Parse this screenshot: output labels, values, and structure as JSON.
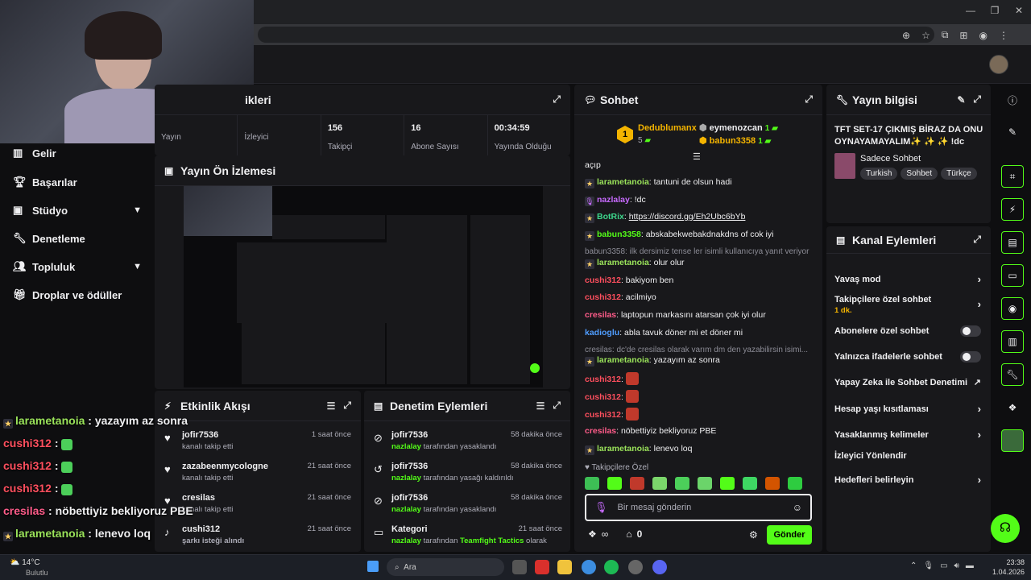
{
  "browser": {
    "min": "—",
    "max": "❐",
    "close": "✕"
  },
  "sidebar": {
    "items": [
      {
        "label": "Gelir",
        "icon": "bar-chart-icon"
      },
      {
        "label": "Başarılar",
        "icon": "trophy-icon"
      },
      {
        "label": "Stüdyo",
        "icon": "video-icon",
        "chevron": true
      },
      {
        "label": "Denetleme",
        "icon": "wrench-icon"
      },
      {
        "label": "Topluluk",
        "icon": "people-icon",
        "chevron": true
      },
      {
        "label": "Droplar ve ödüller",
        "icon": "gift-icon"
      }
    ]
  },
  "stats": {
    "title_fragment": "ikleri",
    "cells": [
      {
        "value": "",
        "label": "Yayın"
      },
      {
        "value": "",
        "label": "İzleyici"
      },
      {
        "value": "156",
        "label": "Takipçi"
      },
      {
        "value": "16",
        "label": "Abone Sayısı"
      },
      {
        "value": "00:34:59",
        "label": "Yayında Olduğu"
      }
    ]
  },
  "preview": {
    "title": "Yayın Ön İzlemesi"
  },
  "activity": {
    "title": "Etkinlik Akışı",
    "items": [
      {
        "user": "jofir7536",
        "desc": "kanalı takip etti",
        "time": "1 saat önce"
      },
      {
        "user": "zazabeenmycologne",
        "desc": "kanalı takip etti",
        "time": "21 saat önce"
      },
      {
        "user": "cresilas",
        "desc": "kanalı takip etti",
        "time": "21 saat önce"
      },
      {
        "user": "cushi312",
        "desc": "şarkı isteği alındı",
        "time": "21 saat önce"
      }
    ]
  },
  "moderation": {
    "title": "Denetim Eylemleri",
    "items": [
      {
        "user": "jofir7536",
        "by": "nazlalay",
        "desc": "tarafından yasaklandı",
        "time": "58 dakika önce"
      },
      {
        "user": "jofir7536",
        "by": "nazlalay",
        "desc": "tarafından yasağı kaldırıldı",
        "time": "58 dakika önce"
      },
      {
        "user": "jofir7536",
        "by": "nazlalay",
        "desc": "tarafından yasaklandı",
        "time": "58 dakika önce"
      },
      {
        "user": "Kategori",
        "by": "nazlalay",
        "desc": "tarafından",
        "extra": "Teamfight Tactics",
        "tail": "olarak",
        "time": "21 saat önce"
      }
    ]
  },
  "chat": {
    "title": "Sohbet",
    "leader": {
      "rank": "1",
      "name": "Dedublumanx",
      "count": "5"
    },
    "leaders2": [
      {
        "name": "eymenozcan",
        "count": "1"
      },
      {
        "name": "babun3358",
        "count": "1"
      }
    ],
    "lines": [
      {
        "user": "",
        "msg": "açıp",
        "cls": ""
      },
      {
        "user": "larametanoia",
        "msg": ": tantuni de olsun hadi",
        "cls": "u-lara",
        "badge": true
      },
      {
        "user": "nazlalay",
        "msg": ": !dc",
        "cls": "u-naz",
        "mic": true
      },
      {
        "user": "BotRix",
        "msg": ": ",
        "link": "https://discord.gg/Eh2Ubc6bYb",
        "cls": "u-bot",
        "badge": true
      },
      {
        "user": "babun3358",
        "msg": ": abskabekwebakdnakdns of cok iyi",
        "cls": "u-bab",
        "badge": true
      },
      {
        "reply": "babun3358: ilk dersimiz tense ler isimli kullanıcıya yanıt veriyor"
      },
      {
        "user": "larametanoia",
        "msg": ": olur olur",
        "cls": "u-lara",
        "badge": true
      },
      {
        "user": "cushi312",
        "msg": ": bakiyom ben",
        "cls": "u-cushi"
      },
      {
        "user": "cushi312",
        "msg": ": acilmiyo",
        "cls": "u-cushi"
      },
      {
        "user": "cresilas",
        "msg": ": laptopun markasını atarsan çok iyi olur",
        "cls": "u-cres"
      },
      {
        "user": "kadioglu",
        "msg": ": abla tavuk döner mi et döner mi",
        "cls": "u-kad"
      },
      {
        "reply": "cresilas: dc'de cresilas olarak varım dm den yazabilirsin isimi..."
      },
      {
        "user": "larametanoia",
        "msg": ": yazayım az sonra",
        "cls": "u-lara",
        "badge": true
      },
      {
        "user": "cushi312",
        "msg": ": ",
        "cls": "u-cushi",
        "emote": true
      },
      {
        "user": "cushi312",
        "msg": ": ",
        "cls": "u-cushi",
        "emote": true
      },
      {
        "user": "cushi312",
        "msg": ": ",
        "cls": "u-cushi",
        "emote": true
      },
      {
        "user": "cresilas",
        "msg": ": nöbettiyiz bekliyoruz PBE",
        "cls": "u-cres"
      },
      {
        "user": "larametanoia",
        "msg": ": lenevo loq",
        "cls": "u-lara",
        "badge": true
      }
    ],
    "followers_only": "Takipçilere Özel",
    "input_placeholder": "Bir mesaj gönderin",
    "points": "0",
    "send_label": "Gönder"
  },
  "info": {
    "title": "Yayın bilgisi",
    "stream_title": "TFT SET-17 ÇIKMIŞ BİRAZ DA ONU OYNAYAMAYALIM✨ ✨ ✨ !dc",
    "category": "Sadece Sohbet",
    "tags": [
      "Turkish",
      "Sohbet",
      "Türkçe"
    ]
  },
  "actions": {
    "title": "Kanal Eylemleri",
    "items": [
      {
        "label": "Yavaş mod",
        "type": "chevron"
      },
      {
        "label": "Takipçilere özel sohbet",
        "sub": "1 dk.",
        "type": "chevron"
      },
      {
        "label": "Abonelere özel sohbet",
        "type": "toggle"
      },
      {
        "label": "Yalnızca ifadelerle sohbet",
        "type": "toggle"
      },
      {
        "label": "Yapay Zeka ile Sohbet Denetimi",
        "type": "external"
      },
      {
        "label": "Hesap yaşı kısıtlaması",
        "type": "chevron"
      },
      {
        "label": "Yasaklanmış kelimeler",
        "type": "chevron"
      },
      {
        "label": "İzleyici Yönlendir",
        "type": "none"
      },
      {
        "label": "Hedefleri belirleyin",
        "type": "chevron"
      }
    ]
  },
  "overlay": [
    {
      "user": "larametanoia",
      "msg": " : yazayım az sonra",
      "cls": "u-lara",
      "badge": true
    },
    {
      "user": "cushi312",
      "msg": " :",
      "cls": "u-cushi",
      "emote": true
    },
    {
      "user": "cushi312",
      "msg": " :",
      "cls": "u-cushi",
      "emote": true
    },
    {
      "user": "cushi312",
      "msg": " :",
      "cls": "u-cushi",
      "emote": true
    },
    {
      "user": "cresilas",
      "msg": " : nöbettiyiz bekliyoruz PBE",
      "cls": "u-cres"
    },
    {
      "user": "larametanoia",
      "msg": " : lenevo loq",
      "cls": "u-lara",
      "badge": true
    }
  ],
  "taskbar": {
    "temp": "14°C",
    "weather": "Bulutlu",
    "search": "Ara",
    "time": "23:38",
    "date": "1.04.2026"
  },
  "colors": {
    "accent": "#53fc18",
    "panel": "#18181b",
    "bg": "#0e0e10"
  }
}
